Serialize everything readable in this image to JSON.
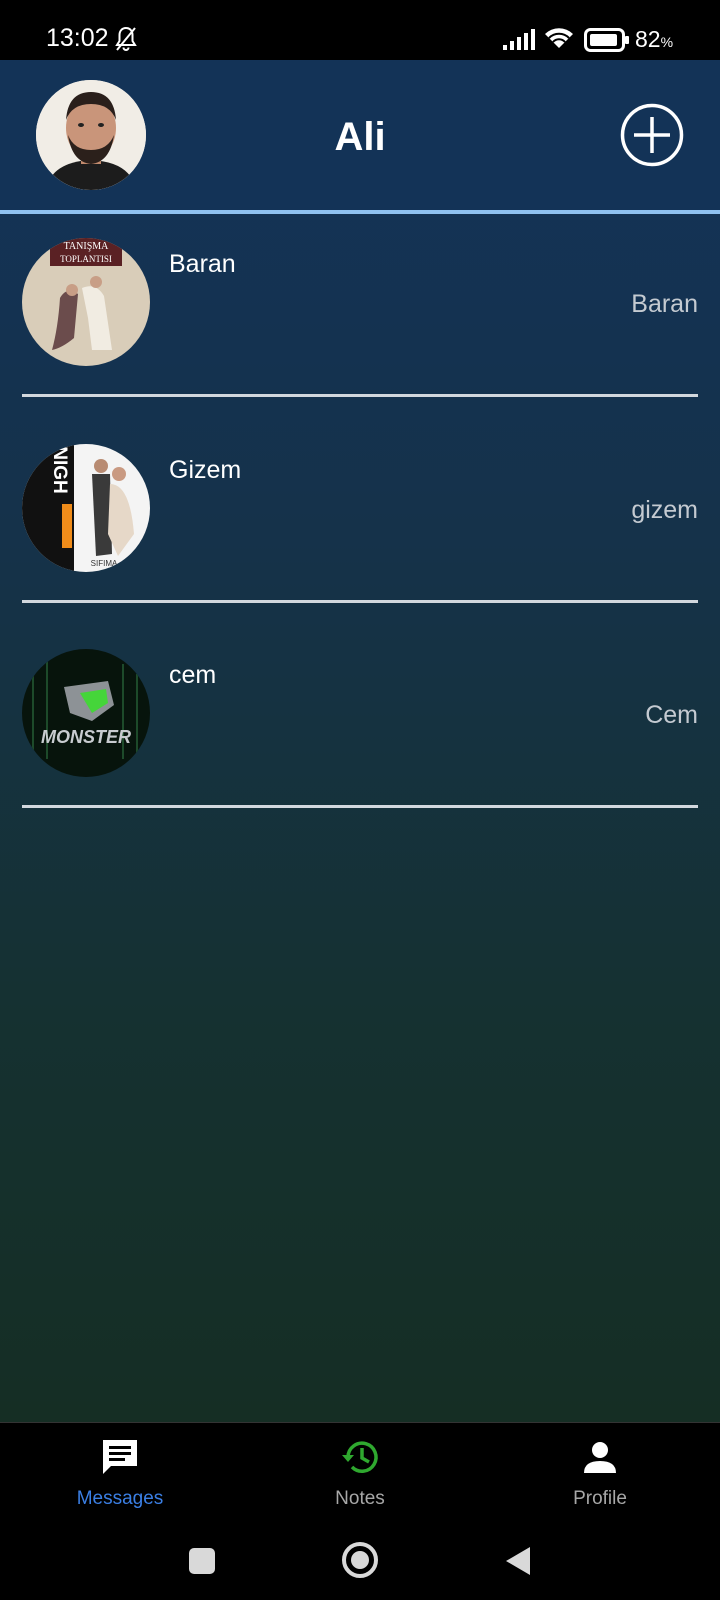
{
  "status_bar": {
    "time": "13:02",
    "battery_value": "82",
    "battery_unit": "%"
  },
  "header": {
    "title": "Ali"
  },
  "chats": [
    {
      "name": "Baran",
      "subtitle": "Baran",
      "avatar_text_1": "TANIŞMA",
      "avatar_text_2": "TOPLANTISI"
    },
    {
      "name": "Gizem",
      "subtitle": "gizem",
      "avatar_text_1": "NIGH",
      "avatar_text_2": "SIFIMA"
    },
    {
      "name": "cem",
      "subtitle": "Cem",
      "avatar_text_1": "MONSTER"
    }
  ],
  "bottom_nav": {
    "messages_label": "Messages",
    "notes_label": "Notes",
    "profile_label": "Profile"
  },
  "colors": {
    "active_tab": "#3b7fe4",
    "inactive_tab": "#a7a7a7",
    "notes_icon": "#2fa82f",
    "header_bg": "#133357",
    "header_line": "#8fc1f0"
  }
}
